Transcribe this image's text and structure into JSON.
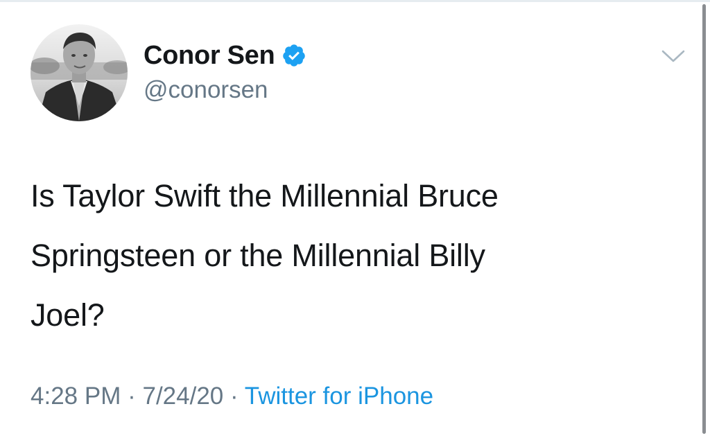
{
  "tweet": {
    "author": {
      "display_name": "Conor Sen",
      "handle": "@conorsen",
      "verified": true,
      "avatar": "profile-photo"
    },
    "text": "Is Taylor Swift the Millennial Bruce\nSpringsteen or the Millennial Billy\nJoel?",
    "time": "4:28 PM",
    "separator": "·",
    "date": "7/24/20",
    "source": "Twitter for iPhone",
    "menu_icon": "chevron-down-icon",
    "verified_icon": "verified-badge-icon"
  },
  "colors": {
    "text": "#14171a",
    "secondary": "#657786",
    "accent": "#1b95e0",
    "verified": "#1da1f2"
  }
}
